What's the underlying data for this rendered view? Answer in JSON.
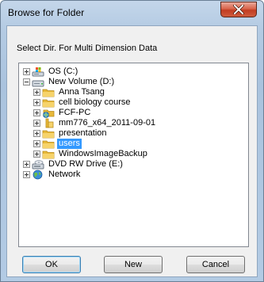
{
  "window": {
    "title": "Browse for Folder"
  },
  "dialog": {
    "prompt": "Select Dir. For Multi Dimension Data"
  },
  "tree": {
    "items": [
      {
        "label": "OS (C:)",
        "icon": "drive-icon",
        "expander": "plus",
        "selected": false
      },
      {
        "label": "New Volume (D:)",
        "icon": "drive-icon",
        "expander": "minus",
        "selected": false
      },
      {
        "label": "Anna Tsang",
        "icon": "folder-icon",
        "expander": "plus",
        "selected": false
      },
      {
        "label": "cell biology course",
        "icon": "folder-icon",
        "expander": "plus",
        "selected": false
      },
      {
        "label": "FCF-PC",
        "icon": "network-folder-icon",
        "expander": "plus",
        "selected": false
      },
      {
        "label": "mm776_x64_2011-09-01",
        "icon": "folder-icon",
        "expander": "plus",
        "selected": false
      },
      {
        "label": "presentation",
        "icon": "folder-icon",
        "expander": "plus",
        "selected": false
      },
      {
        "label": "users",
        "icon": "folder-icon",
        "expander": "plus",
        "selected": true
      },
      {
        "label": "WindowsImageBackup",
        "icon": "folder-icon",
        "expander": "plus",
        "selected": false
      },
      {
        "label": "DVD RW Drive (E:)",
        "icon": "dvd-drive-icon",
        "expander": "plus",
        "selected": false
      },
      {
        "label": "Network",
        "icon": "network-icon",
        "expander": "plus",
        "selected": false
      }
    ]
  },
  "buttons": {
    "ok": "OK",
    "new": "New",
    "cancel": "Cancel"
  },
  "colors": {
    "selection": "#3399ff",
    "close_button": "#c13d22",
    "title_bar": "#b4cbe3",
    "folder": "#e8b93a"
  }
}
